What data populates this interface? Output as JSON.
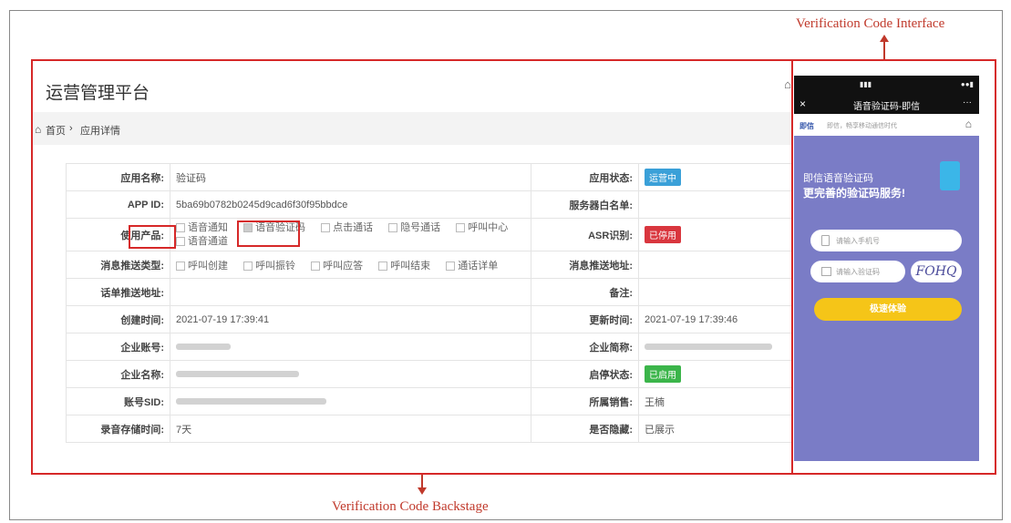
{
  "captions": {
    "top": "Verification Code Interface",
    "bottom": "Verification Code Backstage"
  },
  "backstage": {
    "title": "运营管理平台",
    "breadcrumb": {
      "home": "首页",
      "separator": "›",
      "current": "应用详情"
    },
    "rows": {
      "app_name_label": "应用名称:",
      "app_name": "验证码",
      "app_status_label": "应用状态:",
      "app_status": "运营中",
      "app_id_label": "APP ID:",
      "app_id": "5ba69b0782b0245d9cad6f30f95bbdce",
      "whitelist_label": "服务器白名单:",
      "products_label": "使用产品:",
      "products": [
        "语音通知",
        "语音验证码",
        "点击通话",
        "隐号通话",
        "呼叫中心",
        "语音通道"
      ],
      "asr_label": "ASR识别:",
      "asr": "已停用",
      "msg_type_label": "消息推送类型:",
      "msg_types": [
        "呼叫创建",
        "呼叫振铃",
        "呼叫应答",
        "呼叫结束",
        "通话详单"
      ],
      "msg_url_label": "消息推送地址:",
      "cdr_url_label": "话单推送地址:",
      "remark_label": "备注:",
      "created_label": "创建时间:",
      "created": "2021-07-19 17:39:41",
      "updated_label": "更新时间:",
      "updated": "2021-07-19 17:39:46",
      "ent_account_label": "企业账号:",
      "ent_short_label": "企业简称:",
      "ent_name_label": "企业名称:",
      "enable_label": "启停状态:",
      "enable": "已启用",
      "sid_label": "账号SID:",
      "sales_label": "所属销售:",
      "sales": "王楠",
      "record_label": "录音存储时间:",
      "record": "7天",
      "hidden_label": "是否隐藏:",
      "hidden": "已展示"
    },
    "colors": {
      "running": "#3aa0d8",
      "disabled": "#d9363e",
      "enabled": "#3bb54a"
    }
  },
  "phone": {
    "nav_title": "语音验证码-即信",
    "close": "×",
    "more": "···",
    "brand": "即信",
    "slogan": "即信，畅享移动通信时代",
    "hero_line1": "即信语音验证码",
    "hero_line2": "更完善的验证码服务!",
    "phone_placeholder": "请输入手机号",
    "code_placeholder": "请输入验证码",
    "captcha": "FOHQ",
    "submit": "极速体验",
    "colors": {
      "bg": "#7a7cc6",
      "button": "#f5c518"
    }
  }
}
